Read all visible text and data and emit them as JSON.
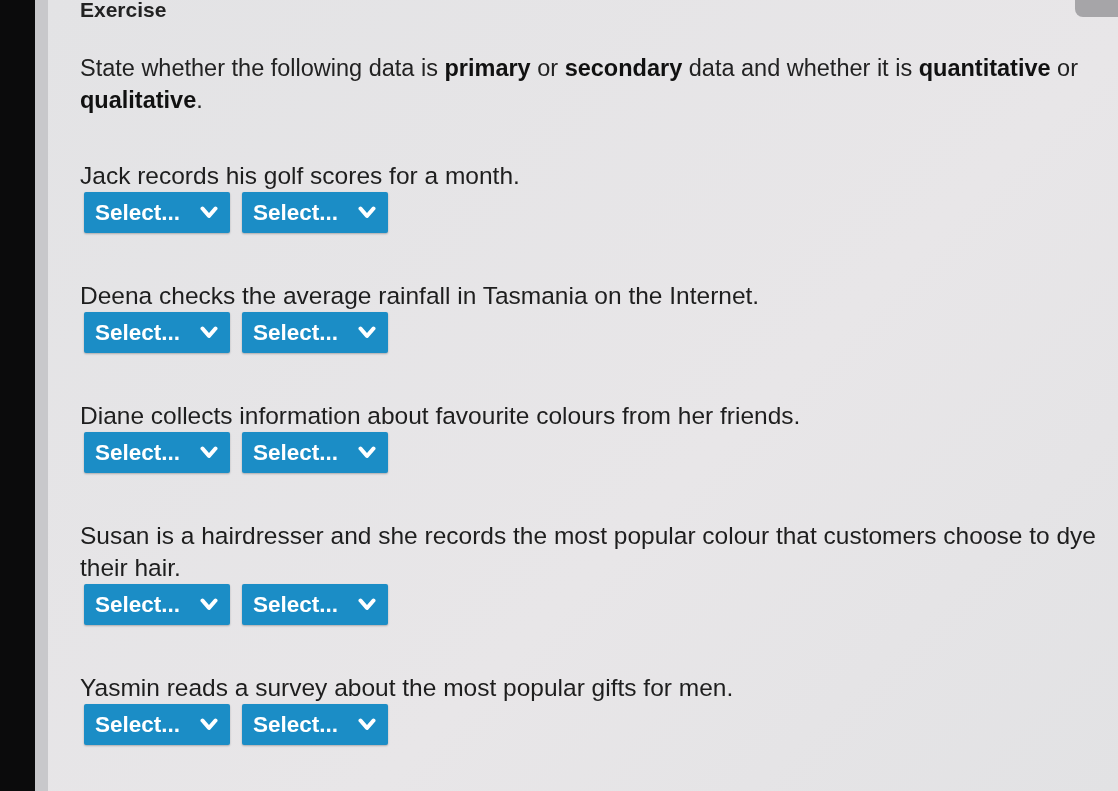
{
  "title": "Exercise",
  "instructions": "State whether the following data is **primary** or **secondary** data and whether it is **quantitative** or **qualitative**.",
  "questions": [
    {
      "text": "Jack records his golf scores for a month.",
      "selects": [
        {
          "label": "Select..."
        },
        {
          "label": "Select..."
        }
      ]
    },
    {
      "text": "Deena checks the average rainfall in Tasmania on the Internet.",
      "selects": [
        {
          "label": "Select..."
        },
        {
          "label": "Select..."
        }
      ]
    },
    {
      "text": "Diane collects information about favourite colours from her friends.",
      "selects": [
        {
          "label": "Select..."
        },
        {
          "label": "Select..."
        }
      ]
    },
    {
      "text": "Susan is a hairdresser and she records the most popular colour that customers choose to dye their hair.",
      "selects": [
        {
          "label": "Select..."
        },
        {
          "label": "Select..."
        }
      ]
    },
    {
      "text": "Yasmin reads a survey about the most popular gifts for men.",
      "selects": [
        {
          "label": "Select..."
        },
        {
          "label": "Select..."
        }
      ]
    }
  ]
}
